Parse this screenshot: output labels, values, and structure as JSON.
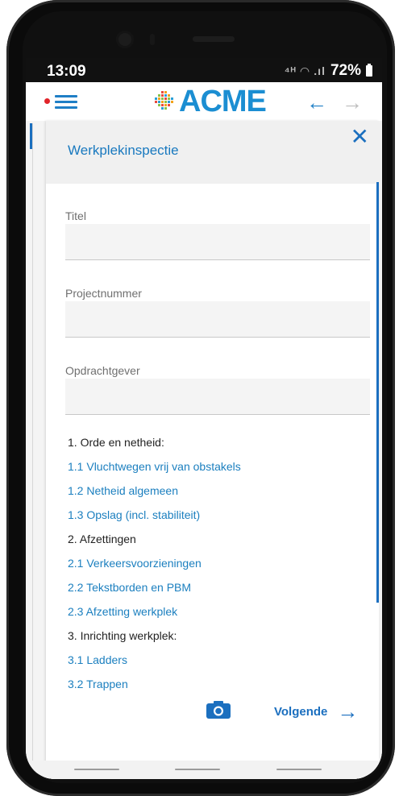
{
  "status": {
    "time": "13:09",
    "signal_icons": "⁴ᴴ ◠ .ıl",
    "battery": "72%"
  },
  "app": {
    "logo_text": "ACME"
  },
  "form": {
    "title": "Werkplekinspectie",
    "fields": [
      {
        "label": "Titel",
        "value": "",
        "placeholder": ""
      },
      {
        "label": "Projectnummer",
        "value": "",
        "placeholder": ""
      },
      {
        "label": "Opdrachtgever",
        "value": "",
        "placeholder": ""
      }
    ],
    "checklist": [
      {
        "text": "1. Orde en netheid:",
        "type": "section"
      },
      {
        "text": "1.1 Vluchtwegen vrij van obstakels",
        "type": "link"
      },
      {
        "text": "1.2 Netheid algemeen",
        "type": "link"
      },
      {
        "text": "1.3 Opslag (incl. stabiliteit)",
        "type": "link"
      },
      {
        "text": "2. Afzettingen",
        "type": "section"
      },
      {
        "text": "2.1 Verkeersvoorzieningen",
        "type": "link"
      },
      {
        "text": "2.2 Tekstborden en PBM",
        "type": "link"
      },
      {
        "text": "2.3 Afzetting werkplek",
        "type": "link"
      },
      {
        "text": "3. Inrichting werkplek:",
        "type": "section"
      },
      {
        "text": "3.1 Ladders",
        "type": "link"
      },
      {
        "text": "3.2 Trappen",
        "type": "link"
      }
    ],
    "next_label": "Volgende"
  },
  "colors": {
    "accent": "#1b6fbf",
    "link": "#1b7fbf",
    "notification": "#e1242a"
  }
}
